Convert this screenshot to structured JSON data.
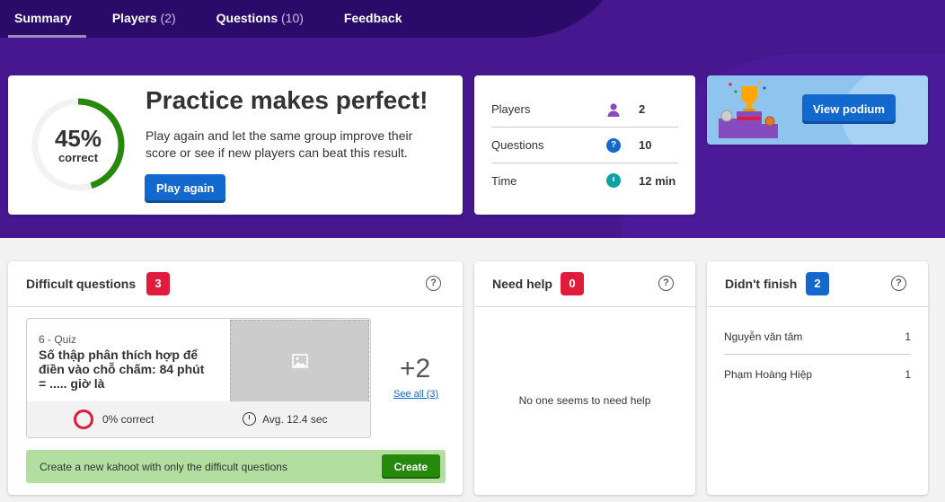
{
  "tabs": [
    {
      "label": "Summary",
      "count": ""
    },
    {
      "label": "Players",
      "count": "(2)"
    },
    {
      "label": "Questions",
      "count": "(10)"
    },
    {
      "label": "Feedback",
      "count": ""
    }
  ],
  "summary": {
    "percent": "45%",
    "percent_value": 0.45,
    "percent_label": "correct",
    "title": "Practice makes perfect!",
    "description": "Play again and let the same group improve their score or see if new players can beat this result.",
    "play_again": "Play again"
  },
  "stats": [
    {
      "label": "Players",
      "value": "2",
      "icon": "person-icon",
      "color": "#864cbf"
    },
    {
      "label": "Questions",
      "value": "10",
      "icon": "question-icon",
      "color": "#1368ce"
    },
    {
      "label": "Time",
      "value": "12 min",
      "icon": "clock-icon",
      "color": "#0aa3a3"
    }
  ],
  "podium": {
    "button": "View podium"
  },
  "difficult": {
    "title": "Difficult questions",
    "count": "3",
    "question_type": "6 - Quiz",
    "question_text": "Số thập phân thích hợp để điền vào chỗ chấm: 84 phút = ..... giờ là",
    "correct": "0% correct",
    "avg": "Avg. 12.4 sec",
    "more": "+2",
    "see_all": "See all (3)",
    "create_text": "Create a new kahoot with only the difficult questions",
    "create_button": "Create"
  },
  "need_help": {
    "title": "Need help",
    "count": "0",
    "empty": "No one seems to need help"
  },
  "didnt_finish": {
    "title": "Didn't finish",
    "count": "2",
    "players": [
      {
        "name": "Nguyễn văn tâm",
        "value": "1"
      },
      {
        "name": "Phạm Hoàng Hiệp",
        "value": "1"
      }
    ]
  },
  "colors": {
    "brand_purple": "#46178f",
    "correct_green": "#26890c",
    "danger_red": "#e21b3c",
    "action_blue": "#1368ce"
  }
}
